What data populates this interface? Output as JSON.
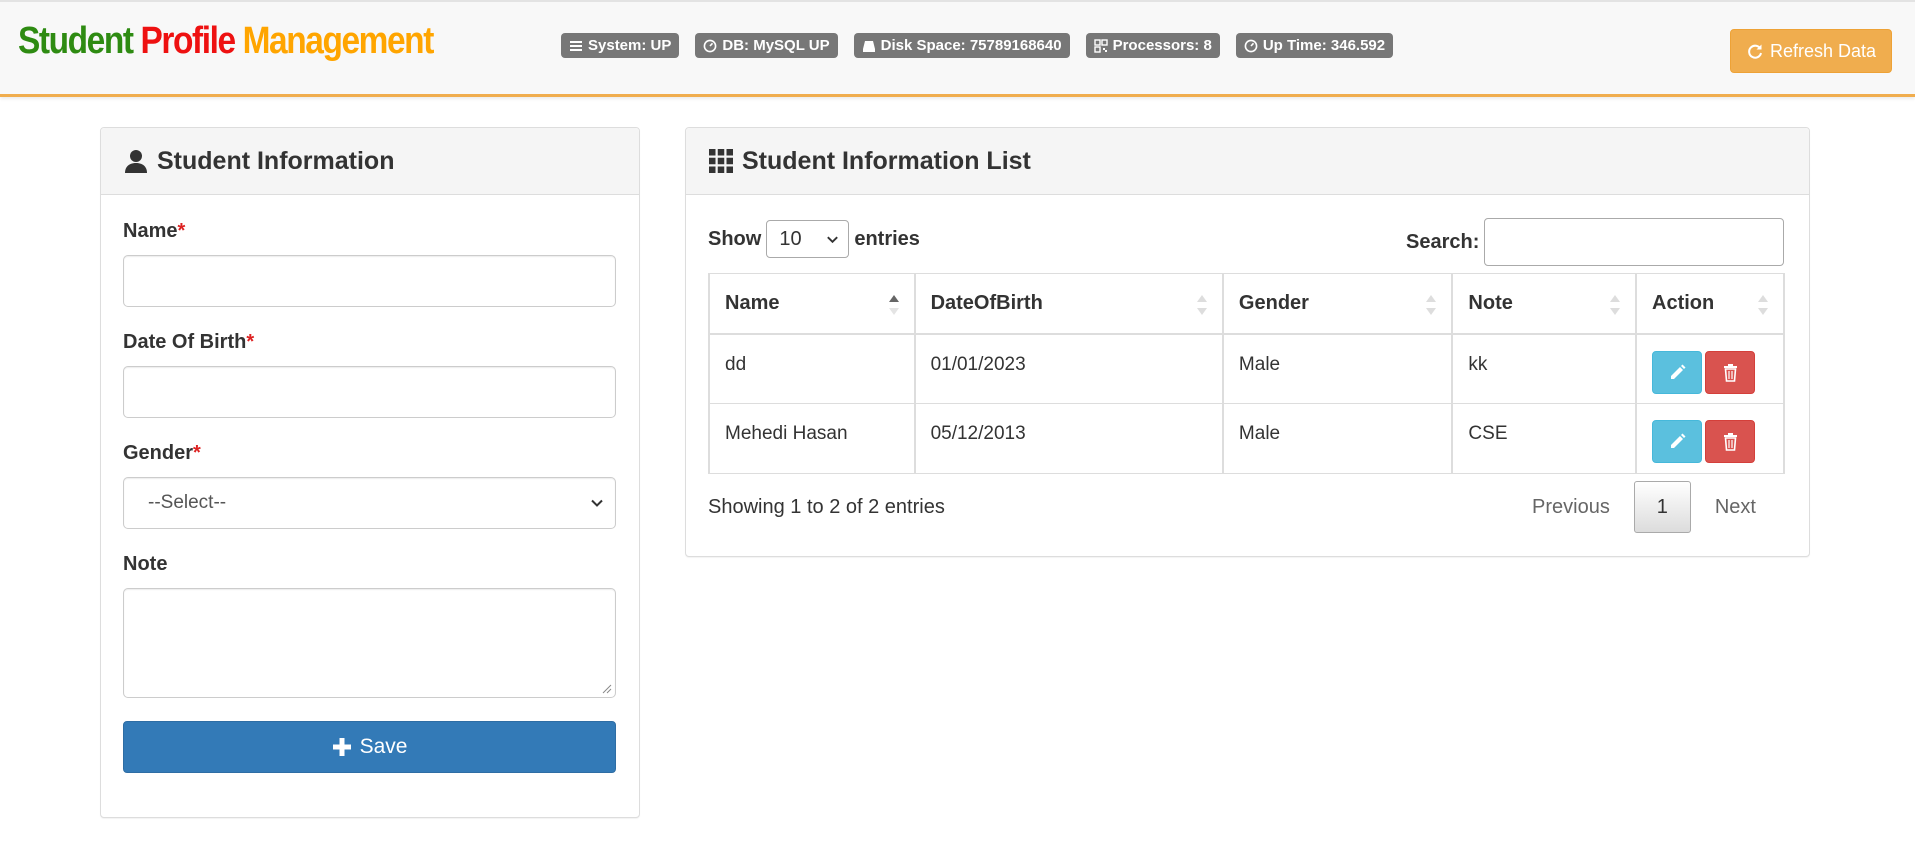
{
  "brand": {
    "word1": "Student",
    "word2": "Profile",
    "word3": "Management"
  },
  "status": [
    {
      "icon": "list-icon",
      "text": "System: UP"
    },
    {
      "icon": "dashboard-icon",
      "text": "DB: MySQL UP"
    },
    {
      "icon": "hdd-icon",
      "text": "Disk Space: 75789168640"
    },
    {
      "icon": "qrcode-icon",
      "text": "Processors: 8"
    },
    {
      "icon": "dashboard-icon",
      "text": "Up Time: 346.592"
    }
  ],
  "refresh_label": "Refresh Data",
  "form": {
    "title": "Student Information",
    "name_label": "Name",
    "dob_label": "Date Of Birth",
    "gender_label": "Gender",
    "gender_value": "--Select--",
    "note_label": "Note",
    "required_mark": "*",
    "save_label": "Save"
  },
  "list": {
    "title": "Student Information List",
    "show_label": "Show",
    "page_length": "10",
    "entries_label": "entries",
    "search_label": "Search:",
    "columns": [
      "Name",
      "DateOfBirth",
      "Gender",
      "Note",
      "Action"
    ],
    "rows": [
      {
        "name": "dd",
        "dob": "01/01/2023",
        "gender": "Male",
        "note": "kk"
      },
      {
        "name": "Mehedi Hasan",
        "dob": "05/12/2013",
        "gender": "Male",
        "note": "CSE"
      }
    ],
    "info": "Showing 1 to 2 of 2 entries",
    "prev_label": "Previous",
    "current_page": "1",
    "next_label": "Next"
  },
  "colors": {
    "brand_green": "#2e8b12",
    "brand_red": "#ee1111",
    "brand_orange": "#ffa500",
    "primary": "#337ab7",
    "warning": "#f0ad4e",
    "info": "#5bc0de",
    "danger": "#d9534f",
    "badge": "#777777"
  }
}
